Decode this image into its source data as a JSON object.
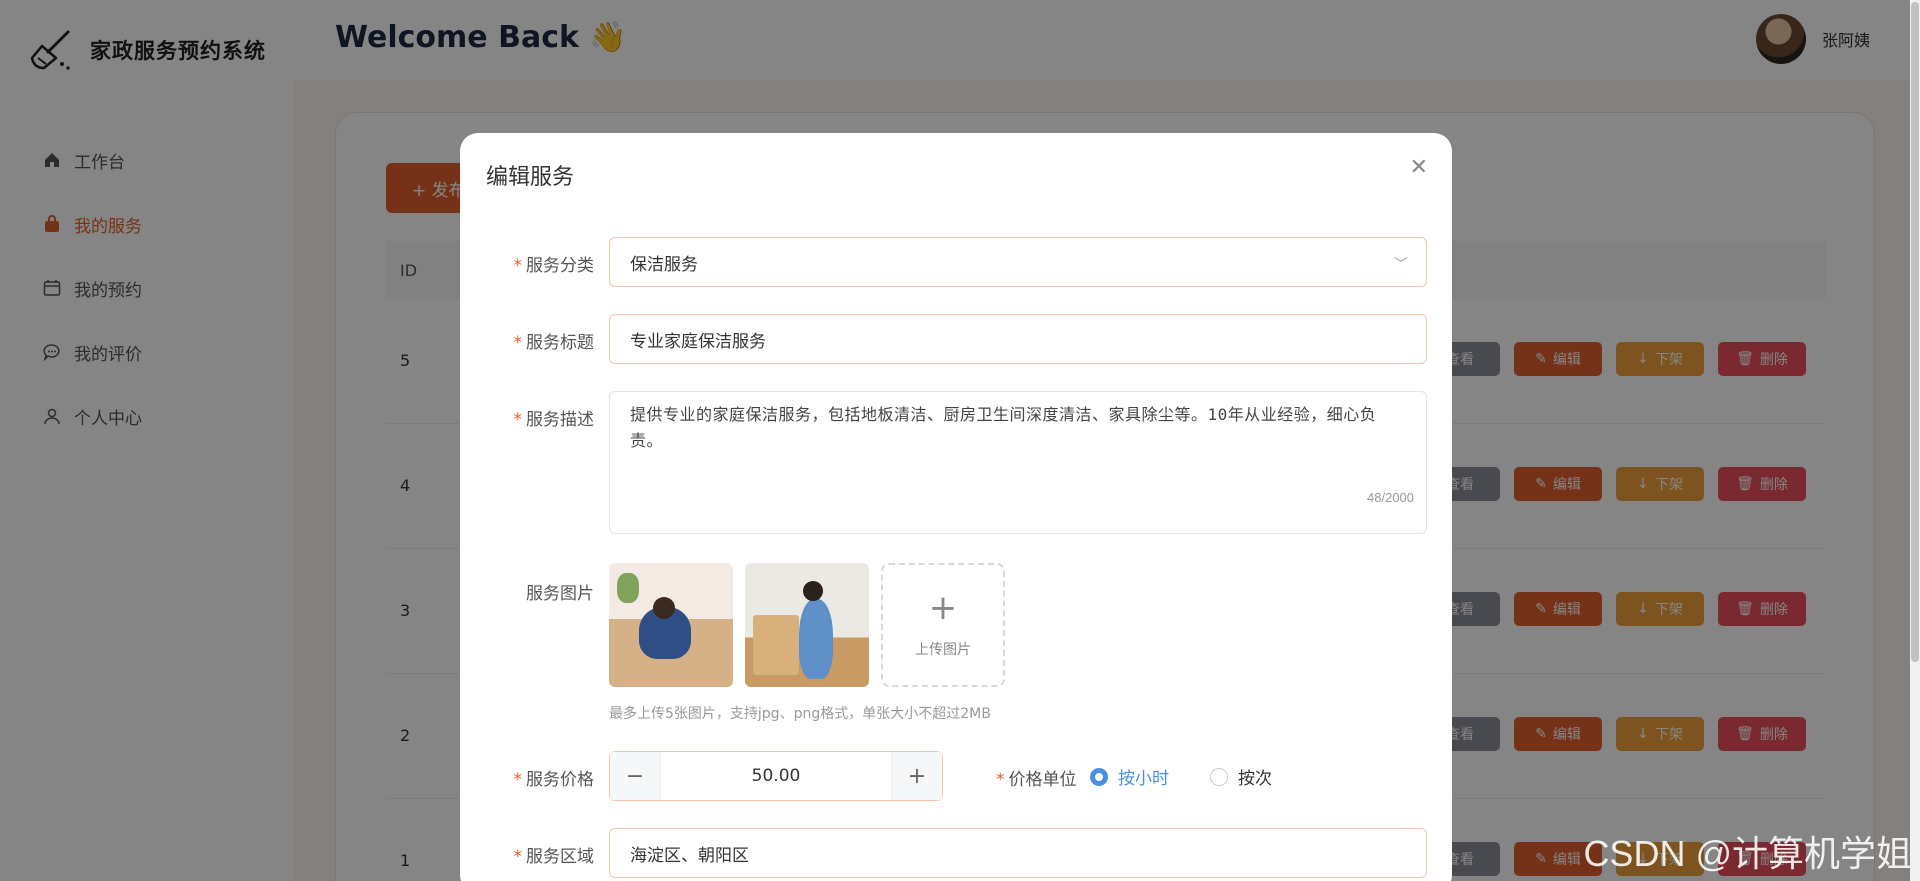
{
  "app": {
    "title": "家政服务预约系统"
  },
  "header": {
    "welcome": "Welcome Back",
    "wave_emoji": "👋",
    "username": "张阿姨"
  },
  "sidebar": {
    "items": [
      {
        "label": "工作台",
        "icon": "home-icon",
        "active": false
      },
      {
        "label": "我的服务",
        "icon": "bag-icon",
        "active": true
      },
      {
        "label": "我的预约",
        "icon": "calendar-icon",
        "active": false
      },
      {
        "label": "我的评价",
        "icon": "comment-icon",
        "active": false
      },
      {
        "label": "个人中心",
        "icon": "user-icon",
        "active": false
      }
    ]
  },
  "main": {
    "publish_button": "+ 发布",
    "table": {
      "id_header": "ID",
      "rows": [
        {
          "id": "5"
        },
        {
          "id": "4"
        },
        {
          "id": "3"
        },
        {
          "id": "2"
        },
        {
          "id": "1"
        }
      ],
      "actions": {
        "view": "查看",
        "edit": "编辑",
        "off": "下架",
        "delete": "删除"
      }
    }
  },
  "modal": {
    "title": "编辑服务",
    "category": {
      "label": "服务分类",
      "value": "保洁服务"
    },
    "title_field": {
      "label": "服务标题",
      "value": "专业家庭保洁服务"
    },
    "description": {
      "label": "服务描述",
      "value": "提供专业的家庭保洁服务，包括地板清洁、厨房卫生间深度清洁、家具除尘等。10年从业经验，细心负责。",
      "counter": "48/2000"
    },
    "images": {
      "label": "服务图片",
      "upload_label": "上传图片",
      "hint": "最多上传5张图片，支持jpg、png格式，单张大小不超过2MB"
    },
    "price": {
      "label": "服务价格",
      "value": "50.00",
      "minus": "−",
      "plus": "+"
    },
    "price_unit": {
      "label": "价格单位",
      "options": [
        "按小时",
        "按次"
      ],
      "selected": "按小时"
    },
    "area": {
      "label": "服务区域",
      "value": "海淀区、朝阳区"
    }
  },
  "watermark": "CSDN @计算机学姐",
  "colors": {
    "accent": "#e2612e",
    "radio_checked": "#4a90e2",
    "edit": "#e2612e",
    "off": "#f0a23c",
    "delete": "#e8505b",
    "view": "#8a8f99"
  }
}
